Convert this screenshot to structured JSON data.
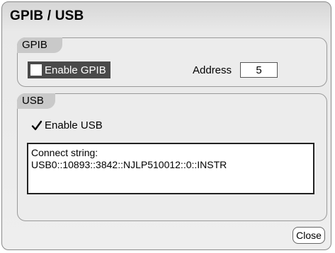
{
  "dialog": {
    "title": "GPIB / USB"
  },
  "gpib": {
    "group_label": "GPIB",
    "enable_label": "Enable GPIB",
    "enabled": false,
    "address_label": "Address",
    "address_value": "5"
  },
  "usb": {
    "group_label": "USB",
    "enable_label": "Enable USB",
    "enabled": true,
    "connect_label": "Connect string:",
    "connect_value": "USB0::10893::3842::NJLP510012::0::INSTR"
  },
  "buttons": {
    "close_label": "Close"
  }
}
